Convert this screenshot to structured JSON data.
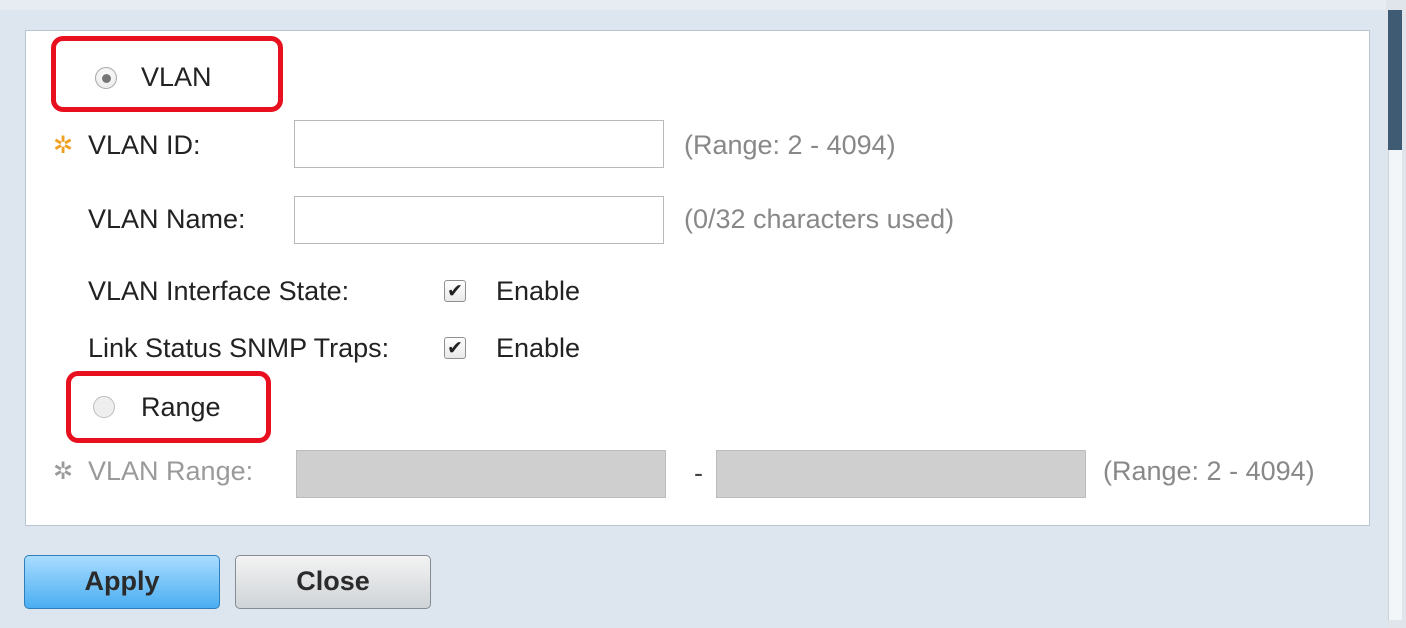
{
  "form": {
    "vlan_option": {
      "label": "VLAN",
      "selected": true
    },
    "vlan_id": {
      "label": "VLAN ID:",
      "value": "",
      "hint": "(Range: 2 - 4094)"
    },
    "vlan_name": {
      "label": "VLAN Name:",
      "value": "",
      "hint": "(0/32 characters used)"
    },
    "interface_state": {
      "label": "VLAN Interface State:",
      "checked": true,
      "checkbox_label": "Enable"
    },
    "link_status_traps": {
      "label": "Link Status SNMP Traps:",
      "checked": true,
      "checkbox_label": "Enable"
    },
    "range_option": {
      "label": "Range",
      "selected": false
    },
    "vlan_range": {
      "label": "VLAN Range:",
      "from": "",
      "to": "",
      "separator": "-",
      "hint": "(Range: 2 - 4094)"
    }
  },
  "buttons": {
    "apply": "Apply",
    "close": "Close"
  },
  "colors": {
    "highlight": "#e8101e",
    "required_icon": "#f0a020",
    "primary_button": "#4aaef1"
  },
  "icons": {
    "required": "gear-icon",
    "check": "checkmark-icon"
  }
}
